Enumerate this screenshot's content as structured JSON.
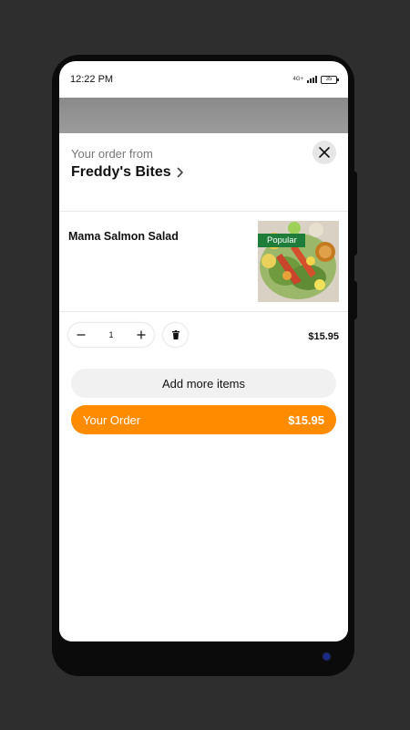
{
  "status_bar": {
    "time": "12:22 PM",
    "network": "4G+",
    "battery": "35"
  },
  "header": {
    "order_from_label": "Your order from",
    "restaurant_name": "Freddy's Bites"
  },
  "cart_item": {
    "name": "Mama Salmon Salad",
    "badge": "Popular",
    "quantity": "1",
    "price": "$15.95"
  },
  "actions": {
    "add_more_label": "Add more items",
    "your_order_label": "Your Order",
    "your_order_total": "$15.95"
  },
  "colors": {
    "accent": "#ff8c00",
    "badge": "#1e7d3a"
  },
  "icons": [
    "close-icon",
    "chevron-right-icon",
    "minus-icon",
    "plus-icon",
    "trash-icon"
  ]
}
